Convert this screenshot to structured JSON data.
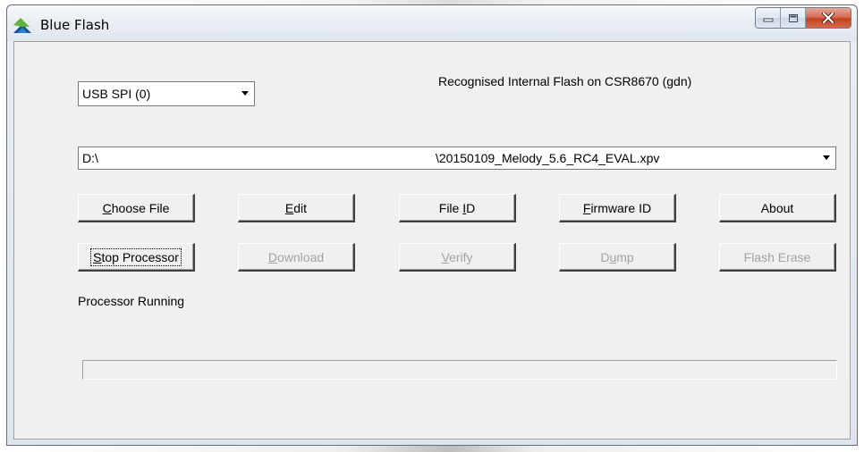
{
  "window": {
    "title": "Blue Flash",
    "controls": {
      "minimize": "minimize",
      "maximize": "maximize",
      "close": "close"
    }
  },
  "port_select": {
    "value": "USB SPI (0)"
  },
  "status_top": "Recognised Internal Flash on CSR8670 (gdn)",
  "file_select": {
    "drive": "D:\\",
    "file": "\\20150109_Melody_5.6_RC4_EVAL.xpv"
  },
  "buttons_row1": [
    {
      "pre": "",
      "u": "C",
      "post": "hoose File",
      "enabled": true
    },
    {
      "pre": "",
      "u": "E",
      "post": "dit",
      "enabled": true
    },
    {
      "pre": "File ",
      "u": "I",
      "post": "D",
      "enabled": true
    },
    {
      "pre": "",
      "u": "F",
      "post": "irmware ID",
      "enabled": true
    },
    {
      "pre": "About",
      "u": "",
      "post": "",
      "enabled": true
    }
  ],
  "buttons_row2": [
    {
      "pre": "",
      "u": "S",
      "post": "top Processor",
      "enabled": true
    },
    {
      "pre": "",
      "u": "D",
      "post": "ownload",
      "enabled": false
    },
    {
      "pre": "",
      "u": "V",
      "post": "erify",
      "enabled": false
    },
    {
      "pre": "D",
      "u": "u",
      "post": "mp",
      "enabled": false
    },
    {
      "pre": "Flash Erase",
      "u": "",
      "post": "",
      "enabled": false
    }
  ],
  "processor_status": "Processor Running",
  "progress": {
    "fraction": 0
  },
  "icons": {
    "app": "blue-flash-app-icon",
    "dropdown": "chevron-down-icon"
  }
}
